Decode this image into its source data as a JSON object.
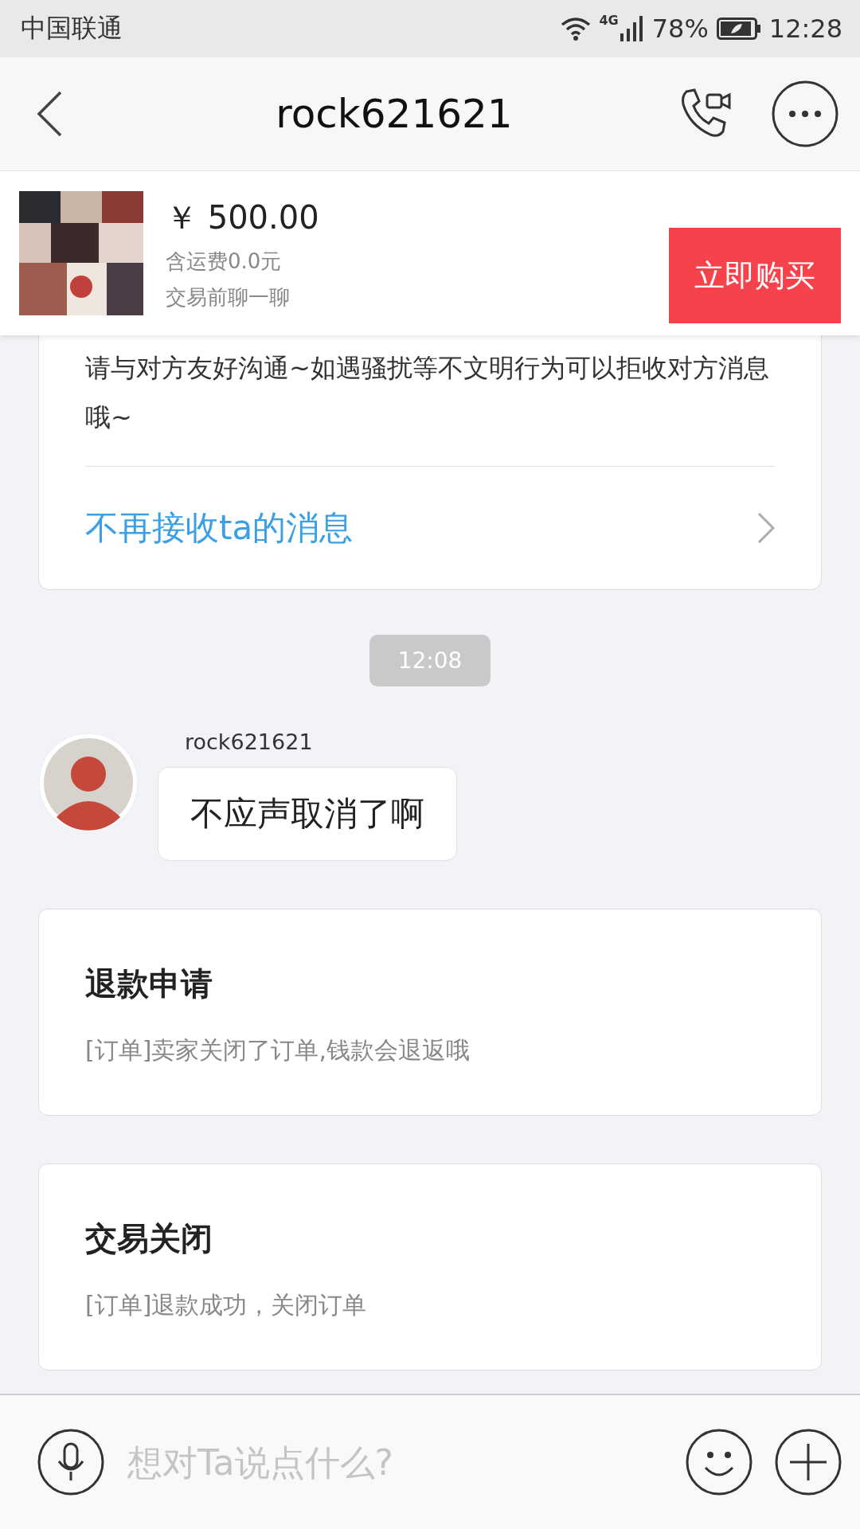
{
  "status_bar": {
    "carrier": "中国联通",
    "network": "4G",
    "battery": "78%",
    "time": "12:28"
  },
  "header": {
    "title": "rock621621"
  },
  "product": {
    "price": "￥ 500.00",
    "shipping": "含运费0.0元",
    "note": "交易前聊一聊",
    "buy_button": "立即购买"
  },
  "notice": {
    "text": "请与对方友好沟通~如遇骚扰等不文明行为可以拒收对方消息哦~",
    "link": "不再接收ta的消息"
  },
  "messages": [
    {
      "kind": "time",
      "text": "12:08"
    },
    {
      "kind": "chat",
      "sender": "rock621621",
      "text": "不应声取消了啊"
    },
    {
      "kind": "card",
      "title": "退款申请",
      "body": "[订单]卖家关闭了订单,钱款会退返哦"
    },
    {
      "kind": "card",
      "title": "交易关闭",
      "body": "[订单]退款成功，关闭订单"
    }
  ],
  "input": {
    "placeholder": "想对Ta说点什么?"
  }
}
